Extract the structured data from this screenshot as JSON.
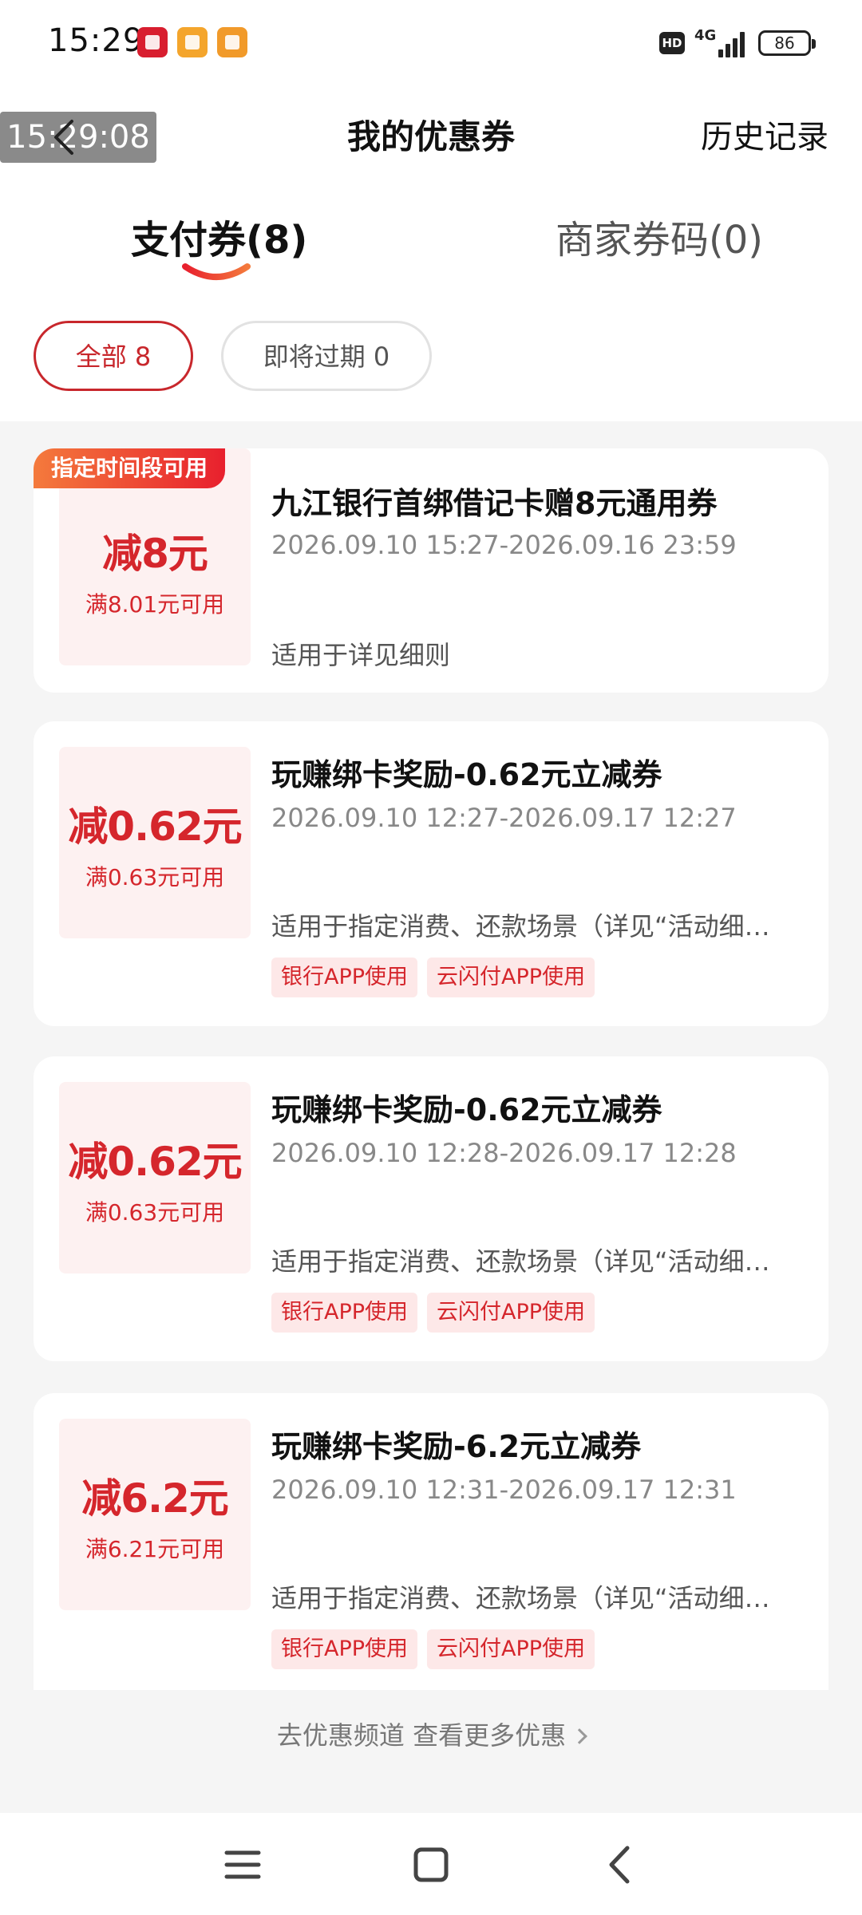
{
  "status_bar": {
    "time": "15:29",
    "hd": "HD",
    "network": "4G",
    "battery": "86"
  },
  "header": {
    "timestamp_overlay": "15:29:08",
    "title": "我的优惠券",
    "history": "历史记录"
  },
  "tabs": [
    {
      "label": "支付券(8)",
      "active": true
    },
    {
      "label": "商家券码(0)",
      "active": false
    }
  ],
  "filters": [
    {
      "label": "全部 8",
      "active": true
    },
    {
      "label": "即将过期 0",
      "active": false
    }
  ],
  "coupons": [
    {
      "badge": "指定时间段可用",
      "amount": "减8元",
      "threshold": "满8.01元可用",
      "title": "九江银行首绑借记卡赠8元通用券",
      "period": "2026.09.10 15:27-2026.09.16 23:59",
      "scope": "适用于详见细则",
      "tags": []
    },
    {
      "amount": "减0.62元",
      "threshold": "满0.63元可用",
      "title": "玩赚绑卡奖励-0.62元立减券",
      "period": "2026.09.10 12:27-2026.09.17 12:27",
      "scope": "适用于指定消费、还款场景（详见“活动细…",
      "tags": [
        "银行APP使用",
        "云闪付APP使用"
      ]
    },
    {
      "amount": "减0.62元",
      "threshold": "满0.63元可用",
      "title": "玩赚绑卡奖励-0.62元立减券",
      "period": "2026.09.10 12:28-2026.09.17 12:28",
      "scope": "适用于指定消费、还款场景（详见“活动细…",
      "tags": [
        "银行APP使用",
        "云闪付APP使用"
      ]
    },
    {
      "amount": "减6.2元",
      "threshold": "满6.21元可用",
      "title": "玩赚绑卡奖励-6.2元立减券",
      "period": "2026.09.10 12:31-2026.09.17 12:31",
      "scope": "适用于指定消费、还款场景（详见“活动细…",
      "tags": [
        "银行APP使用",
        "云闪付APP使用"
      ]
    }
  ],
  "more_link": "去优惠频道 查看更多优惠",
  "colors": {
    "accent_red": "#d5262c",
    "badge_gradient_start": "#f47a3c",
    "badge_gradient_end": "#e8202e",
    "page_bg": "#f5f5f5"
  },
  "icons": {
    "back": "chevron-left-icon",
    "more": "chevron-right-icon",
    "nav_menu": "menu-icon",
    "nav_home": "home-square-icon",
    "nav_back": "back-triangle-icon"
  }
}
